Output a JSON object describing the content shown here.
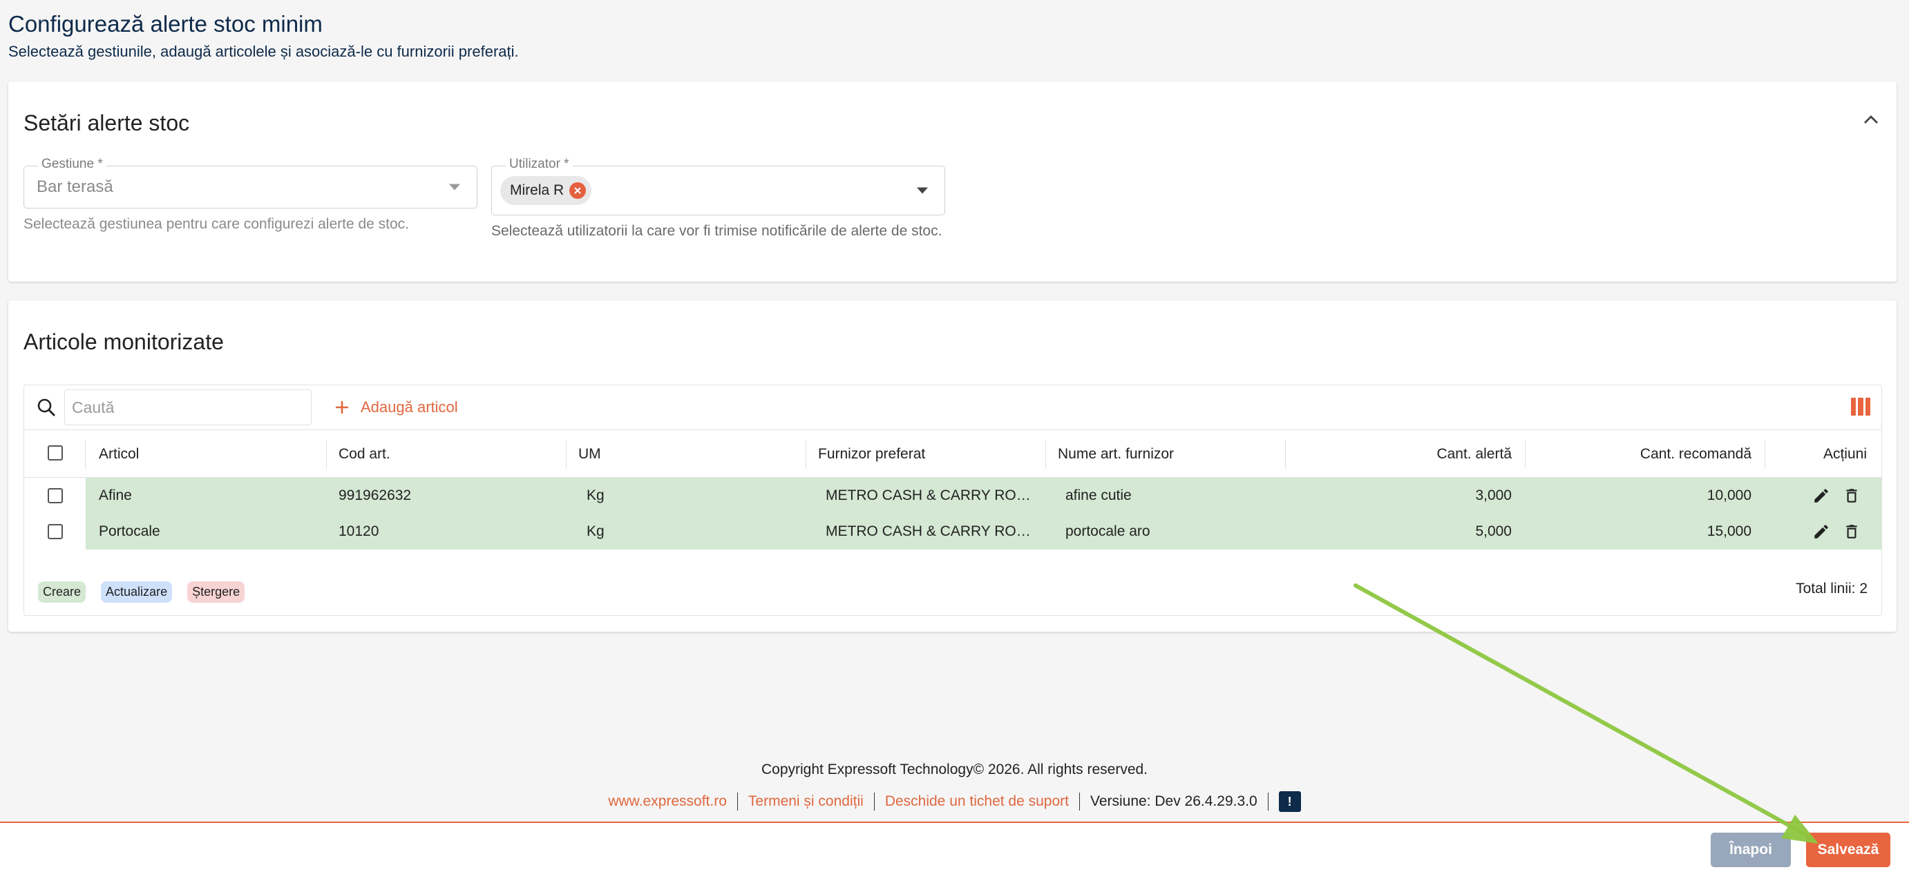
{
  "page": {
    "title": "Configurează alerte stoc minim",
    "subtitle": "Selectează gestiunile, adaugă articolele și asociază-le cu furnizorii preferați."
  },
  "settings": {
    "title": "Setări alerte stoc",
    "gestiune": {
      "label": "Gestiune *",
      "value": "Bar terasă",
      "helper": "Selectează gestiunea pentru care configurezi alerte de stoc."
    },
    "utilizator": {
      "label": "Utilizator *",
      "chip": "Mirela R",
      "helper": "Selectează utilizatorii la care vor fi trimise notificările de alerte de stoc."
    }
  },
  "articles": {
    "title": "Articole monitorizate",
    "search_placeholder": "Caută",
    "add_label": "Adaugă articol",
    "columns": {
      "articol": "Articol",
      "cod": "Cod art.",
      "um": "UM",
      "furnizor": "Furnizor preferat",
      "nume_furnizor": "Nume art. furnizor",
      "cant_alerta": "Cant. alertă",
      "cant_recomandata": "Cant. recomandă",
      "actiuni": "Acțiuni"
    },
    "rows": [
      {
        "articol": "Afine",
        "cod": "991962632",
        "um": "Kg",
        "furnizor": "METRO CASH & CARRY ROMA...",
        "nume_furnizor": "afine cutie",
        "cant_alerta": "3,000",
        "cant_recomandata": "10,000"
      },
      {
        "articol": "Portocale",
        "cod": "10120",
        "um": "Kg",
        "furnizor": "METRO CASH & CARRY ROMA...",
        "nume_furnizor": "portocale aro",
        "cant_alerta": "5,000",
        "cant_recomandata": "15,000"
      }
    ],
    "legend": {
      "create": "Creare",
      "update": "Actualizare",
      "delete": "Ștergere"
    },
    "total": "Total linii: 2"
  },
  "footer": {
    "copyright": "Copyright Expressoft Technology© 2026. All rights reserved.",
    "link_site": "www.expressoft.ro",
    "link_terms": "Termeni și condiții",
    "link_ticket": "Deschide un tichet de suport",
    "version": "Versiune: Dev 26.4.29.3.0"
  },
  "actions": {
    "back": "Înapoi",
    "save": "Salvează"
  },
  "colors": {
    "accent": "#e8653f",
    "row_create": "#d4e8d3",
    "navy": "#0d2a4a",
    "annotation_arrow": "#8dc63f"
  }
}
